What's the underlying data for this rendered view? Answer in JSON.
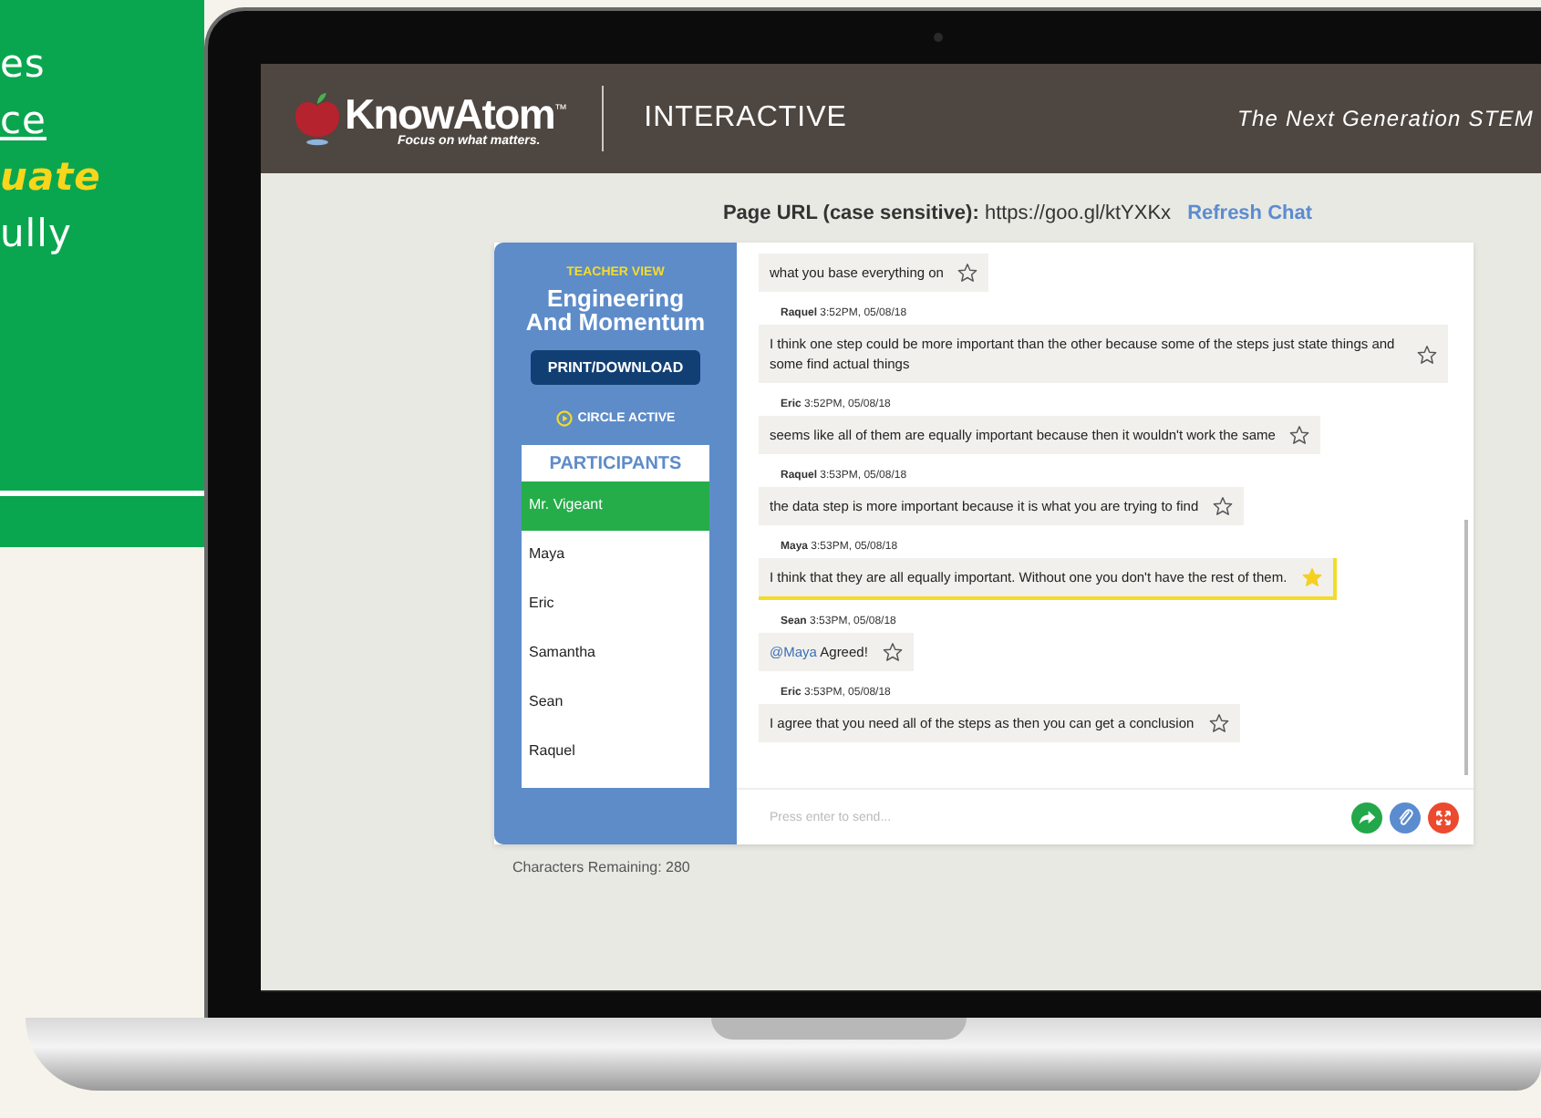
{
  "promo_panel": {
    "lines": [
      {
        "text": "es",
        "kind": "plain"
      },
      {
        "text": "ce",
        "kind": "link"
      },
      {
        "text": "uate",
        "kind": "highlight"
      },
      {
        "text": "ully",
        "kind": "plain"
      }
    ]
  },
  "header": {
    "logo_name": "KnowAtom",
    "logo_mark": "™",
    "logo_tagline": "Focus on what matters.",
    "section": "INTERACTIVE",
    "tagline": "The Next Generation STEM"
  },
  "page_url": {
    "label": "Page URL (case sensitive):",
    "url": "https://goo.gl/ktYXKx",
    "refresh_link": "Refresh Chat"
  },
  "sidebar": {
    "view_label": "TEACHER VIEW",
    "title": "Engineering And Momentum",
    "print_button": "PRINT/DOWNLOAD",
    "circle_status": "CIRCLE ACTIVE",
    "participants_heading": "PARTICIPANTS",
    "participants": [
      {
        "name": "Mr. Vigeant",
        "selected": true
      },
      {
        "name": "Maya",
        "selected": false
      },
      {
        "name": "Eric",
        "selected": false
      },
      {
        "name": "Samantha",
        "selected": false
      },
      {
        "name": "Sean",
        "selected": false
      },
      {
        "name": "Raquel",
        "selected": false
      }
    ]
  },
  "messages": [
    {
      "text": "what you base everything on",
      "starred": false
    },
    {
      "author": "Raquel",
      "time": "3:52PM, 05/08/18",
      "text": "I think one step could be more important than the other because some of the steps just state things and some find actual things",
      "starred": false
    },
    {
      "author": "Eric",
      "time": "3:52PM, 05/08/18",
      "text": "seems like all of them are equally important because then it wouldn't work the same",
      "starred": false
    },
    {
      "author": "Raquel",
      "time": "3:53PM, 05/08/18",
      "text": "the data step is more important because it is what you are trying to find",
      "starred": false
    },
    {
      "author": "Maya",
      "time": "3:53PM, 05/08/18",
      "text": "I think that they are all equally important. Without one you don't have the rest of them.",
      "starred": true
    },
    {
      "author": "Sean",
      "time": "3:53PM, 05/08/18",
      "mention": "@Maya",
      "text": "Agreed!",
      "starred": false
    },
    {
      "author": "Eric",
      "time": "3:53PM, 05/08/18",
      "text": "I agree that you need all of the steps as then you can get a conclusion",
      "starred": false
    }
  ],
  "composer": {
    "placeholder": "Press enter to send..."
  },
  "characters_remaining": "Characters Remaining: 280"
}
